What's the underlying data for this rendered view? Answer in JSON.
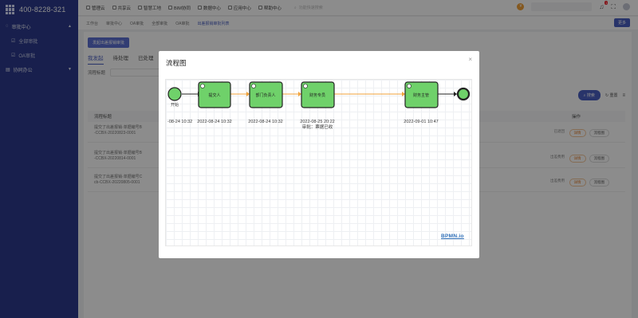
{
  "sidebar": {
    "phone": "400-8228-321",
    "groups": [
      {
        "label": "审批中心",
        "items": [
          {
            "label": "全部审批"
          },
          {
            "label": "OA审批"
          }
        ]
      },
      {
        "label": "协同办公"
      }
    ]
  },
  "topbar": {
    "menu": [
      {
        "label": "管理云"
      },
      {
        "label": "共享云"
      },
      {
        "label": "智慧工地"
      },
      {
        "label": "BIM协同"
      },
      {
        "label": "数据中心"
      },
      {
        "label": "应用中心"
      },
      {
        "label": "帮助中心"
      }
    ],
    "search_placeholder": "功能快速搜索",
    "notification_count": "1"
  },
  "tabs": [
    "工作台",
    "审批中心",
    "OA审批",
    "全部审批",
    "OA审批",
    "出差报销审批列表"
  ],
  "more_label": "更多",
  "content": {
    "top_button": "发起出差报销审批",
    "subtabs": [
      "我发起",
      "待处理",
      "已处理"
    ],
    "filter_label": "流程标题",
    "filter_placeholder": "请输入流程标题",
    "search_label": "搜索",
    "reset_label": "重置",
    "table_headers": {
      "title": "流程标题",
      "ops": "操作"
    },
    "rows": [
      {
        "line1": "提交了出差报销·单据编号B",
        "line2": "-CCBX-20220823-0001",
        "right": "2022",
        "status": "已退回"
      },
      {
        "line1": "提交了出差报销·单据编号B",
        "line2": "-CCBX-20220814-0001",
        "right": "2022",
        "status": "出差费用"
      },
      {
        "line1": "提交了出差报销·单据编号C",
        "line2": "cb-CCBX-20220805-0001",
        "right": "2022",
        "status": "出差费用"
      }
    ],
    "op_detail": "详情",
    "op_flow": "流程图"
  },
  "modal": {
    "title": "流程图",
    "close": "×",
    "logo": "BPMN.io",
    "start_label": "开始",
    "tasks": [
      {
        "name": "提交人",
        "time": "2022-08-24 10:32"
      },
      {
        "name": "部门负责人",
        "time": "2022-08-24 10:32"
      },
      {
        "name": "财务专员",
        "time": "2022-08-25 20:22",
        "note": "审批：票据已收"
      },
      {
        "name": "财务主管",
        "time": "2022-09-01 10:47"
      }
    ],
    "start_time": "-08-24 10:32",
    "colors": {
      "task_fill": "#6fd16a",
      "line": "#f0a13a",
      "start_fill": "#6fd16a"
    }
  }
}
